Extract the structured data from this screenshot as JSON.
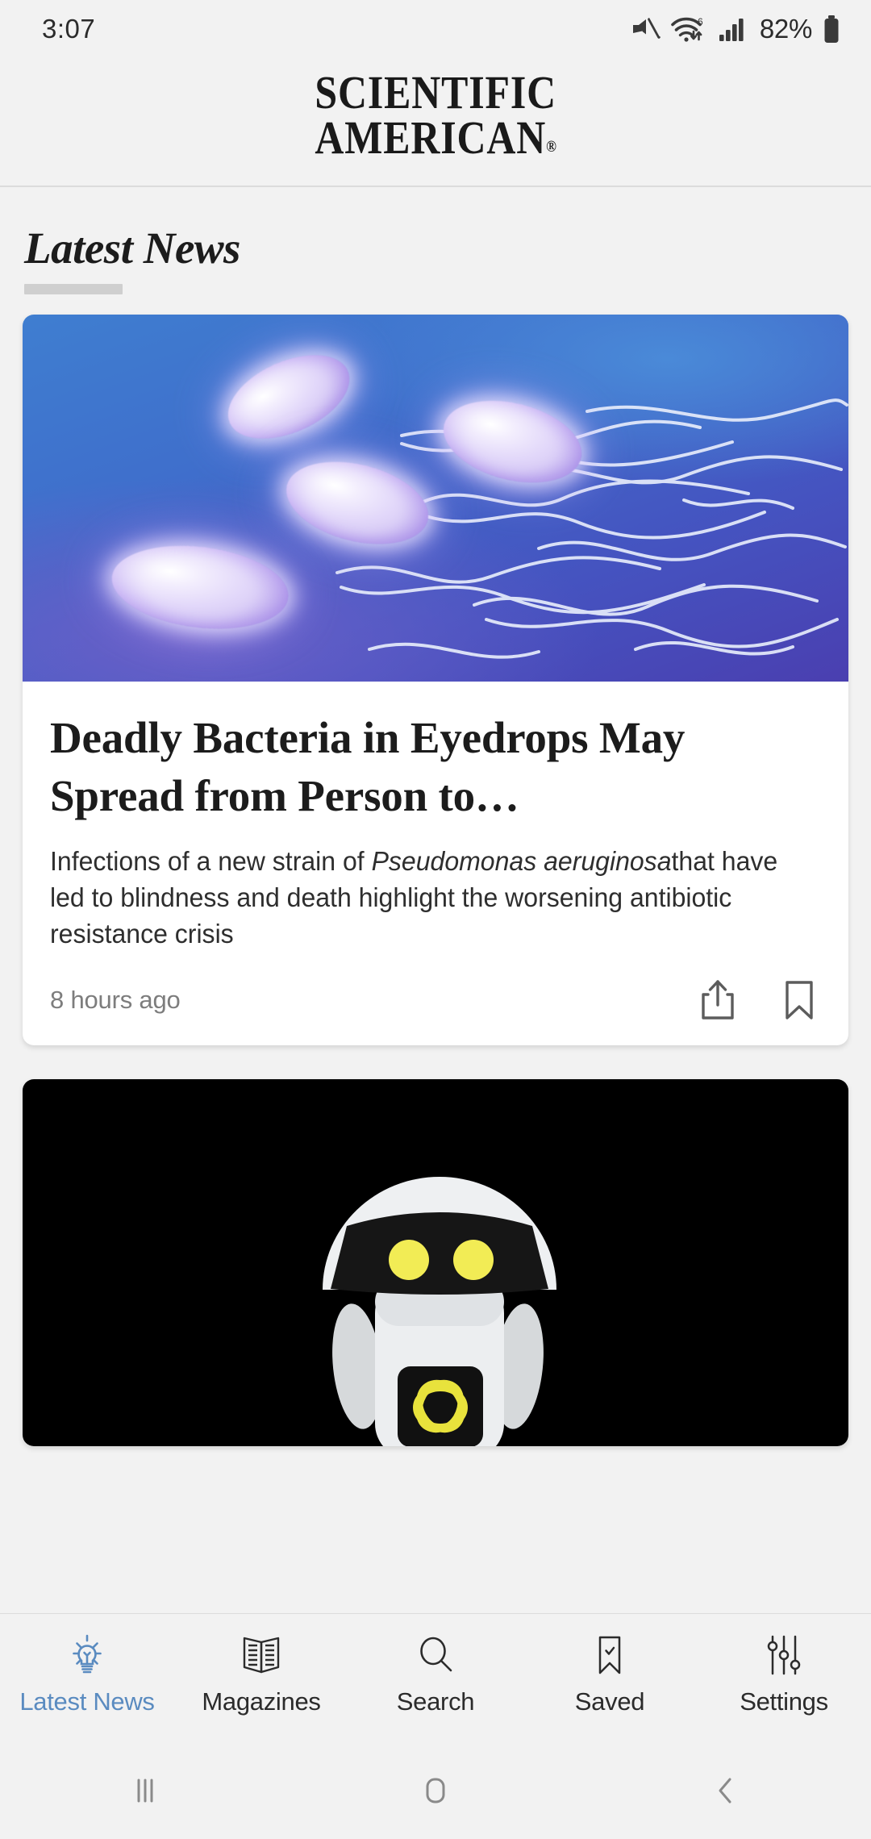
{
  "status_bar": {
    "time": "3:07",
    "battery_percent": "82%",
    "icons": [
      "mute-icon",
      "wifi-6-icon",
      "cellular-signal-icon",
      "battery-icon"
    ]
  },
  "masthead": {
    "line1": "SCIENTIFIC",
    "line2": "AMERICAN",
    "registered_mark": "®"
  },
  "section": {
    "title": "Latest News"
  },
  "articles": [
    {
      "image_alt": "pseudomonas-bacteria-illustration",
      "headline": "Deadly Bacteria in Eyedrops May Spread from Person to…",
      "dek_part1": "Infections of a new strain of ",
      "dek_italic": "Pseudomonas aeruginosa",
      "dek_part2": "that have led to blindness and death highlight the worsening antibiotic resistance crisis",
      "timestamp": "8 hours ago",
      "share_icon": "share-icon",
      "bookmark_icon": "bookmark-icon"
    },
    {
      "image_alt": "white-ai-robot-with-yellow-eyes"
    }
  ],
  "tabs": [
    {
      "label": "Latest News",
      "icon": "lightbulb-icon",
      "active": true
    },
    {
      "label": "Magazines",
      "icon": "open-book-icon",
      "active": false
    },
    {
      "label": "Search",
      "icon": "search-icon",
      "active": false
    },
    {
      "label": "Saved",
      "icon": "bookmark-check-icon",
      "active": false
    },
    {
      "label": "Settings",
      "icon": "sliders-icon",
      "active": false
    }
  ],
  "system_nav": {
    "recents": "recents-icon",
    "home": "home-icon",
    "back": "back-icon"
  },
  "colors": {
    "page_background": "#f2f2f2",
    "card_background": "#ffffff",
    "accent_blue": "#5a8bc0",
    "text_primary": "#1c1c1c",
    "text_muted": "#7d7d7d",
    "underline_gray": "#cfcfcf"
  }
}
